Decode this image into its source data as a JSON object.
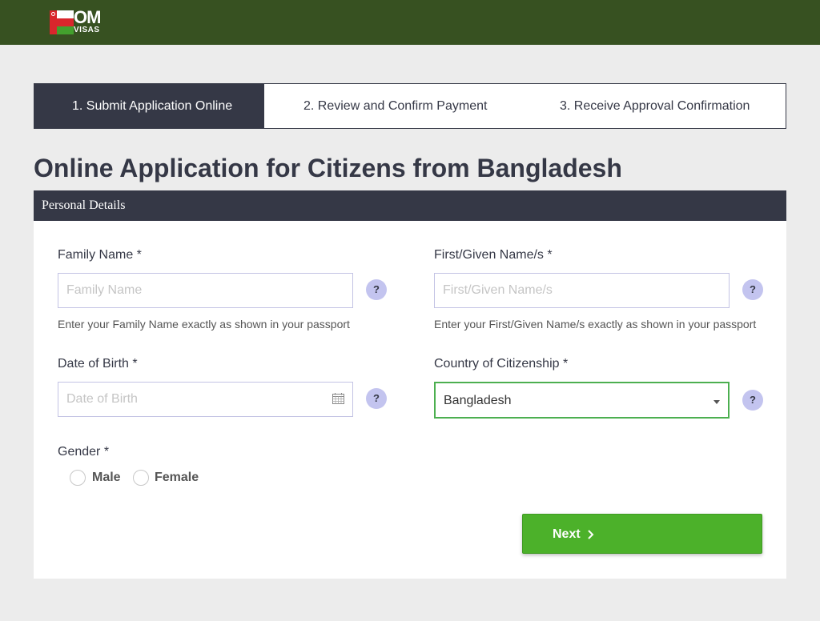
{
  "header": {
    "logo": {
      "line1": "OM",
      "line2": "VISAS"
    },
    "colors": {
      "background": "#375121"
    }
  },
  "steps": [
    {
      "label": "1. Submit Application Online",
      "active": true
    },
    {
      "label": "2. Review and Confirm Payment",
      "active": false
    },
    {
      "label": "3. Receive Approval Confirmation",
      "active": false
    }
  ],
  "page": {
    "title": "Online Application for Citizens from Bangladesh",
    "section": "Personal Details"
  },
  "form": {
    "family_name": {
      "label": "Family Name *",
      "placeholder": "Family Name",
      "value": "",
      "hint": "Enter your Family Name exactly as shown in your passport",
      "help": "?"
    },
    "given_name": {
      "label": "First/Given Name/s *",
      "placeholder": "First/Given Name/s",
      "value": "",
      "hint": "Enter your First/Given Name/s exactly as shown in your passport",
      "help": "?"
    },
    "dob": {
      "label": "Date of Birth *",
      "placeholder": "Date of Birth",
      "value": "",
      "icon": "calendar-icon",
      "help": "?"
    },
    "citizenship": {
      "label": "Country of Citizenship *",
      "selected": "Bangladesh",
      "help": "?"
    },
    "gender": {
      "label": "Gender *",
      "options": [
        "Male",
        "Female"
      ],
      "selected": null
    },
    "next_button": {
      "label": "Next"
    }
  },
  "theme": {
    "dark": "#353846",
    "accent_green": "#4cb12a",
    "help_bubble": "#c3c4ef",
    "select_border": "#4caf50"
  }
}
